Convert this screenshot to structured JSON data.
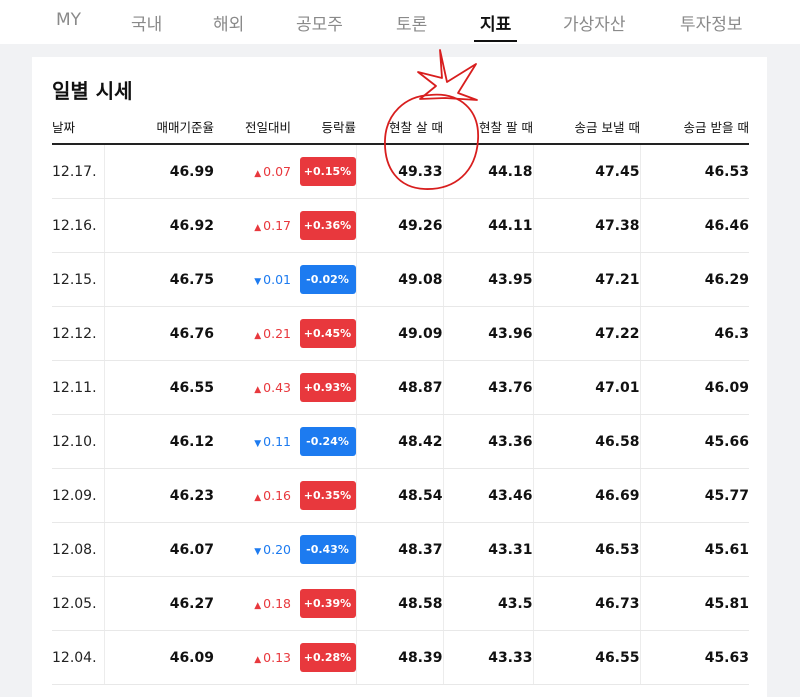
{
  "tabs": [
    {
      "label": "MY",
      "active": false
    },
    {
      "label": "국내",
      "active": false
    },
    {
      "label": "해외",
      "active": false
    },
    {
      "label": "공모주",
      "active": false
    },
    {
      "label": "토론",
      "active": false
    },
    {
      "label": "지표",
      "active": true
    },
    {
      "label": "가상자산",
      "active": false
    },
    {
      "label": "투자정보",
      "active": false
    }
  ],
  "section_title": "일별 시세",
  "columns": [
    "날짜",
    "매매기준율",
    "전일대비",
    "등락률",
    "현찰 살 때",
    "현찰 팔 때",
    "송금 보낼 때",
    "송금 받을 때"
  ],
  "colors": {
    "up": "#e8383d",
    "down": "#1d7bf0",
    "annotation": "#d81e1e"
  },
  "rows": [
    {
      "date": "12.17.",
      "base": "46.99",
      "dir": "up",
      "change": "0.07",
      "rate": "+0.15%",
      "cash_buy": "49.33",
      "cash_sell": "44.18",
      "send": "47.45",
      "receive": "46.53"
    },
    {
      "date": "12.16.",
      "base": "46.92",
      "dir": "up",
      "change": "0.17",
      "rate": "+0.36%",
      "cash_buy": "49.26",
      "cash_sell": "44.11",
      "send": "47.38",
      "receive": "46.46"
    },
    {
      "date": "12.15.",
      "base": "46.75",
      "dir": "down",
      "change": "0.01",
      "rate": "-0.02%",
      "cash_buy": "49.08",
      "cash_sell": "43.95",
      "send": "47.21",
      "receive": "46.29"
    },
    {
      "date": "12.12.",
      "base": "46.76",
      "dir": "up",
      "change": "0.21",
      "rate": "+0.45%",
      "cash_buy": "49.09",
      "cash_sell": "43.96",
      "send": "47.22",
      "receive": "46.3"
    },
    {
      "date": "12.11.",
      "base": "46.55",
      "dir": "up",
      "change": "0.43",
      "rate": "+0.93%",
      "cash_buy": "48.87",
      "cash_sell": "43.76",
      "send": "47.01",
      "receive": "46.09"
    },
    {
      "date": "12.10.",
      "base": "46.12",
      "dir": "down",
      "change": "0.11",
      "rate": "-0.24%",
      "cash_buy": "48.42",
      "cash_sell": "43.36",
      "send": "46.58",
      "receive": "45.66"
    },
    {
      "date": "12.09.",
      "base": "46.23",
      "dir": "up",
      "change": "0.16",
      "rate": "+0.35%",
      "cash_buy": "48.54",
      "cash_sell": "43.46",
      "send": "46.69",
      "receive": "45.77"
    },
    {
      "date": "12.08.",
      "base": "46.07",
      "dir": "down",
      "change": "0.20",
      "rate": "-0.43%",
      "cash_buy": "48.37",
      "cash_sell": "43.31",
      "send": "46.53",
      "receive": "45.61"
    },
    {
      "date": "12.05.",
      "base": "46.27",
      "dir": "up",
      "change": "0.18",
      "rate": "+0.39%",
      "cash_buy": "48.58",
      "cash_sell": "43.5",
      "send": "46.73",
      "receive": "45.81"
    },
    {
      "date": "12.04.",
      "base": "46.09",
      "dir": "up",
      "change": "0.13",
      "rate": "+0.28%",
      "cash_buy": "48.39",
      "cash_sell": "43.33",
      "send": "46.55",
      "receive": "45.63"
    }
  ]
}
